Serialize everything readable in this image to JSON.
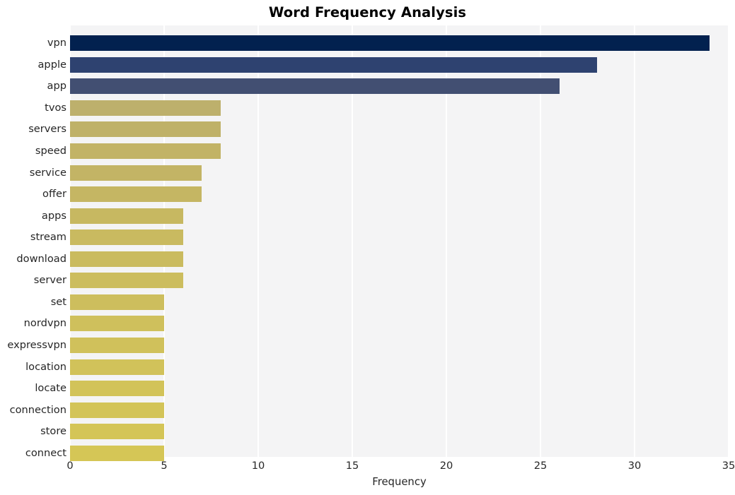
{
  "chart_data": {
    "type": "bar",
    "orientation": "horizontal",
    "title": "Word Frequency Analysis",
    "xlabel": "Frequency",
    "ylabel": "",
    "categories": [
      "vpn",
      "apple",
      "app",
      "tvos",
      "servers",
      "speed",
      "service",
      "offer",
      "apps",
      "stream",
      "download",
      "server",
      "set",
      "nordvpn",
      "expressvpn",
      "location",
      "locate",
      "connection",
      "store",
      "connect"
    ],
    "values": [
      34,
      28,
      26,
      8,
      8,
      8,
      7,
      7,
      6,
      6,
      6,
      6,
      5,
      5,
      5,
      5,
      5,
      5,
      5,
      5
    ],
    "bar_colors": [
      "#02214f",
      "#2e4270",
      "#424f72",
      "#bdb06c",
      "#bfb168",
      "#c2b366",
      "#c3b465",
      "#c5b663",
      "#c7b861",
      "#c9ba60",
      "#cabb5f",
      "#ccbd5e",
      "#cdbe5d",
      "#cfc05c",
      "#d0c15b",
      "#d1c25a",
      "#d2c359",
      "#d3c458",
      "#d4c557",
      "#d5c656"
    ],
    "xlim": [
      0,
      35
    ],
    "ylim_count": 20,
    "xticks": [
      0,
      5,
      10,
      15,
      20,
      25,
      30,
      35
    ],
    "xtick_labels": [
      "0",
      "5",
      "10",
      "15",
      "20",
      "25",
      "30",
      "35"
    ],
    "grid": true,
    "grid_axis": "x",
    "grid_color": "#ffffff",
    "plot_background": "#f4f4f5",
    "figure_background": "#ffffff",
    "tick_label_color": "#262626",
    "legend": null
  }
}
